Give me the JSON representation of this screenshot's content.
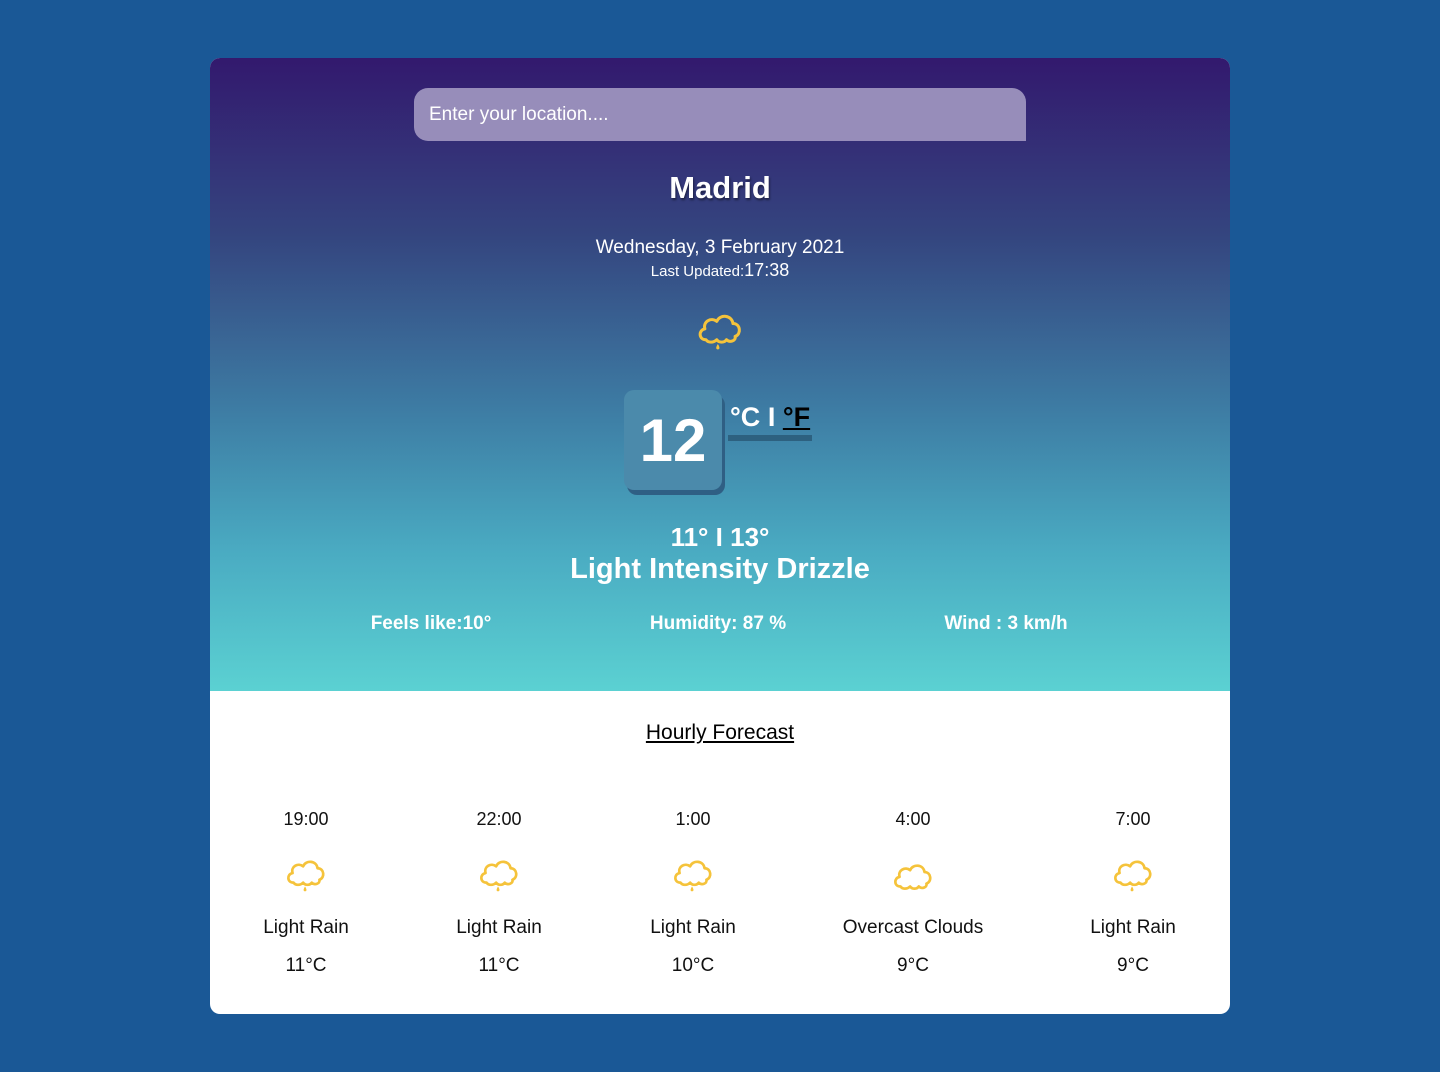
{
  "search": {
    "placeholder": "Enter your location...."
  },
  "current": {
    "city": "Madrid",
    "date": "Wednesday, 3 February 2021",
    "last_updated_label": "Last Updated:",
    "last_updated_time": "17:38",
    "icon": "drizzle-cloud-icon",
    "temperature": "12",
    "unit_celsius": "°C",
    "unit_separator": "I",
    "unit_fahrenheit": "°F",
    "min_max": "11° I 13°",
    "description": "Light Intensity Drizzle",
    "feels_like": "Feels like:10°",
    "humidity": "Humidity: 87 %",
    "wind": "Wind : 3 km/h"
  },
  "hourly": {
    "title": "Hourly Forecast",
    "items": [
      {
        "time": "19:00",
        "icon": "rain-cloud-icon",
        "description": "Light Rain",
        "temp": "11°C"
      },
      {
        "time": "22:00",
        "icon": "rain-cloud-icon",
        "description": "Light Rain",
        "temp": "11°C"
      },
      {
        "time": "1:00",
        "icon": "rain-cloud-icon",
        "description": "Light Rain",
        "temp": "10°C"
      },
      {
        "time": "4:00",
        "icon": "cloud-icon",
        "description": "Overcast Clouds",
        "temp": "9°C"
      },
      {
        "time": "7:00",
        "icon": "rain-cloud-icon",
        "description": "Light Rain",
        "temp": "9°C"
      }
    ]
  },
  "colors": {
    "page_background": "#1a5896",
    "gradient_top": "#33196e",
    "gradient_bottom": "#5bd1d2",
    "search_background": "#978dba",
    "temp_box": "#4b8aab",
    "icon_yellow": "#f5c33b"
  }
}
